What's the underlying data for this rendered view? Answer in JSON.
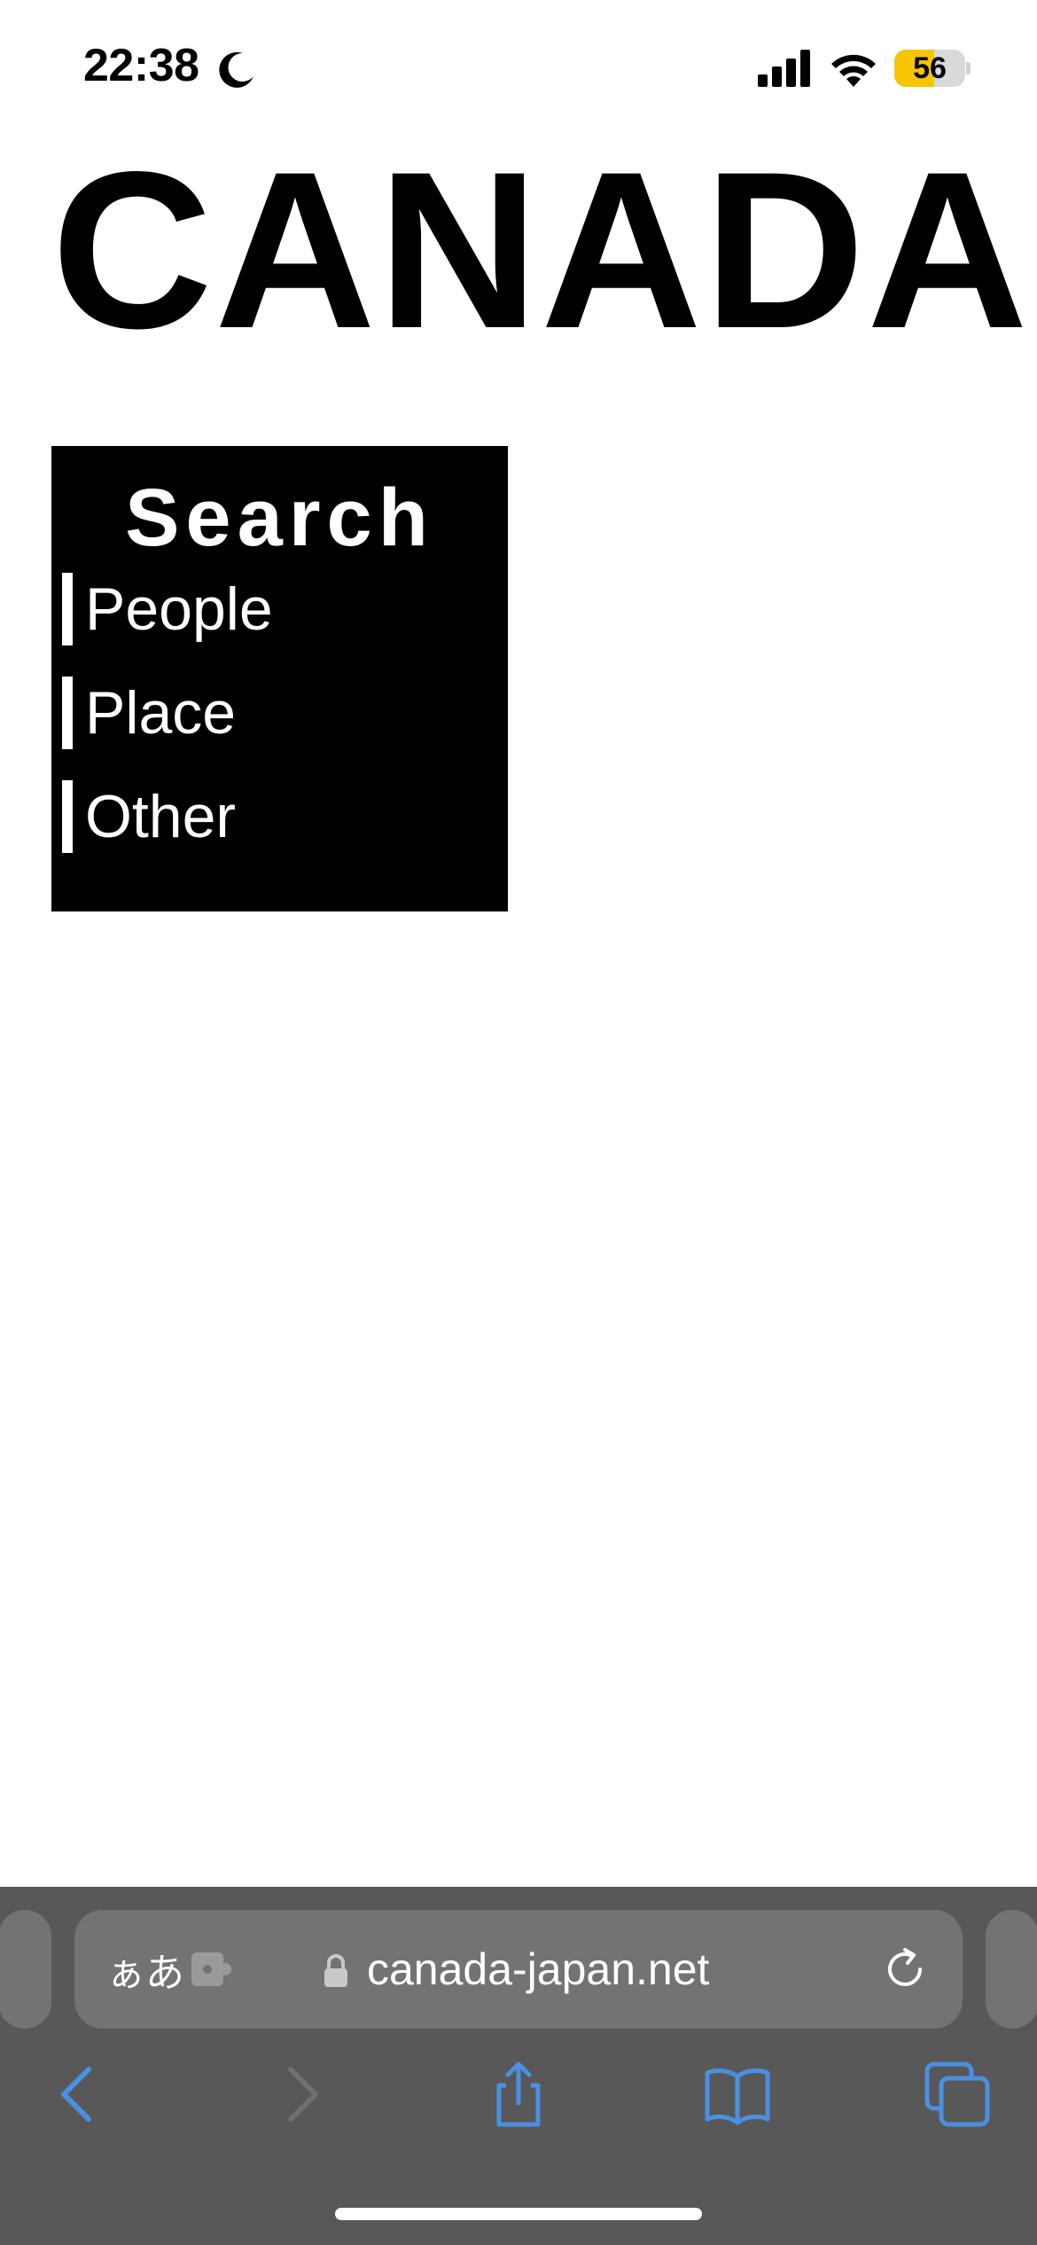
{
  "status_bar": {
    "time": "22:38",
    "battery_level": "56",
    "battery_fraction": 0.56,
    "battery_color": "#f7c600",
    "icons": [
      "moon-icon",
      "signal-icon",
      "wifi-icon",
      "battery-icon"
    ]
  },
  "page": {
    "title": "CANADA",
    "search": {
      "heading": "Search",
      "items": [
        {
          "label": "People"
        },
        {
          "label": "Place"
        },
        {
          "label": "Other"
        }
      ]
    }
  },
  "browser": {
    "text_size_button": "ぁあ",
    "url": "canada-japan.net",
    "accent_color": "#4a90e2",
    "icons": [
      "extension-icon",
      "lock-icon",
      "reload-icon",
      "back-icon",
      "forward-icon",
      "share-icon",
      "bookmarks-icon",
      "tabs-icon"
    ]
  }
}
